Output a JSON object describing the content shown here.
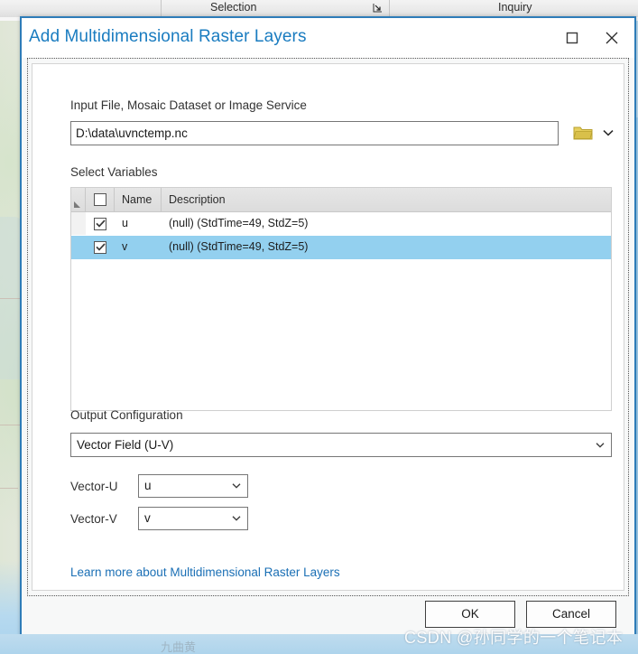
{
  "ribbon": {
    "groups": [
      {
        "label": "Selection"
      },
      {
        "label": "Inquiry"
      }
    ],
    "launcher_icon": "dialog-launcher-icon"
  },
  "dialog": {
    "title": "Add Multidimensional Raster Layers",
    "maximize_icon": "maximize-icon",
    "close_icon": "close-icon",
    "input_file": {
      "label": "Input File, Mosaic Dataset or Image Service",
      "value": "D:\\data\\uvnctemp.nc",
      "placeholder": "",
      "browse_icon": "folder-icon",
      "dropdown_icon": "chevron-down-icon"
    },
    "select_variables": {
      "label": "Select Variables",
      "columns": [
        "",
        "",
        "Name",
        "Description"
      ],
      "header_checkbox_checked": false,
      "rows": [
        {
          "checked": true,
          "name": "u",
          "description": "(null) (StdTime=49, StdZ=5)",
          "selected": false
        },
        {
          "checked": true,
          "name": "v",
          "description": "(null) (StdTime=49, StdZ=5)",
          "selected": true
        }
      ]
    },
    "output_configuration": {
      "label": "Output Configuration",
      "value": "Vector Field (U-V)",
      "vector_u": {
        "label": "Vector-U",
        "value": "u"
      },
      "vector_v": {
        "label": "Vector-V",
        "value": "v"
      }
    },
    "help_link": "Learn more about Multidimensional Raster Layers",
    "buttons": {
      "ok": "OK",
      "cancel": "Cancel"
    }
  },
  "watermark": "CSDN @孙同学的一个笔记本",
  "map_label": "九曲黄",
  "colors": {
    "dialog_border": "#2e7cb8",
    "title_blue": "#1a7cc0",
    "link_blue": "#1a6fb5",
    "row_selected": "#93d0ef",
    "folder_yellow": "#dcc24a"
  }
}
